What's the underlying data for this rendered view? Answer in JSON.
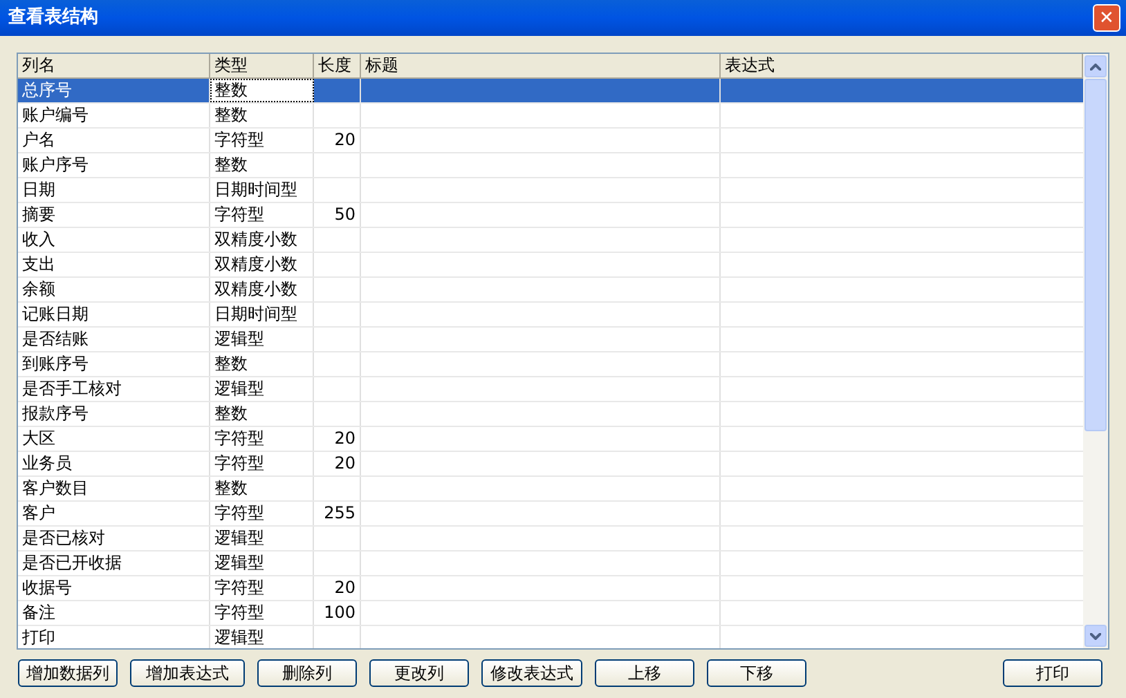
{
  "window": {
    "title": "查看表结构",
    "close": "✕"
  },
  "table": {
    "columns": [
      "列名",
      "类型",
      "长度",
      "标题",
      "表达式"
    ],
    "rows": [
      {
        "name": "总序号",
        "type": "整数",
        "selected": true,
        "focused": true
      },
      {
        "name": "账户编号",
        "type": "整数",
        "selected": false,
        "focused": false
      },
      {
        "name": "户名",
        "type": "字符型",
        "length": "20",
        "selected": false,
        "focused": false
      },
      {
        "name": "账户序号",
        "type": "整数",
        "selected": false,
        "focused": false
      },
      {
        "name": "日期",
        "type": "日期时间型",
        "selected": false,
        "focused": false
      },
      {
        "name": "摘要",
        "type": "字符型",
        "length": "50",
        "selected": false,
        "focused": false
      },
      {
        "name": "收入",
        "type": "双精度小数",
        "selected": false,
        "focused": false
      },
      {
        "name": "支出",
        "type": "双精度小数",
        "selected": false,
        "focused": false
      },
      {
        "name": "余额",
        "type": "双精度小数",
        "selected": false,
        "focused": false
      },
      {
        "name": "记账日期",
        "type": "日期时间型",
        "selected": false,
        "focused": false
      },
      {
        "name": "是否结账",
        "type": "逻辑型",
        "selected": false,
        "focused": false
      },
      {
        "name": "到账序号",
        "type": "整数",
        "selected": false,
        "focused": false
      },
      {
        "name": "是否手工核对",
        "type": "逻辑型",
        "selected": false,
        "focused": false
      },
      {
        "name": "报款序号",
        "type": "整数",
        "selected": false,
        "focused": false
      },
      {
        "name": "大区",
        "type": "字符型",
        "length": "20",
        "selected": false,
        "focused": false
      },
      {
        "name": "业务员",
        "type": "字符型",
        "length": "20",
        "selected": false,
        "focused": false
      },
      {
        "name": "客户数目",
        "type": "整数",
        "selected": false,
        "focused": false
      },
      {
        "name": "客户",
        "type": "字符型",
        "length": "255",
        "selected": false,
        "focused": false
      },
      {
        "name": "是否已核对",
        "type": "逻辑型",
        "selected": false,
        "focused": false
      },
      {
        "name": "是否已开收据",
        "type": "逻辑型",
        "selected": false,
        "focused": false
      },
      {
        "name": "收据号",
        "type": "字符型",
        "length": "20",
        "selected": false,
        "focused": false
      },
      {
        "name": "备注",
        "type": "字符型",
        "length": "100",
        "selected": false,
        "focused": false
      },
      {
        "name": "打印",
        "type": "逻辑型",
        "selected": false,
        "focused": false
      }
    ]
  },
  "buttons": [
    "增加数据列",
    "增加表达式",
    "删除列",
    "更改列",
    "修改表达式",
    "上移",
    "下移"
  ],
  "print_button": "打印"
}
